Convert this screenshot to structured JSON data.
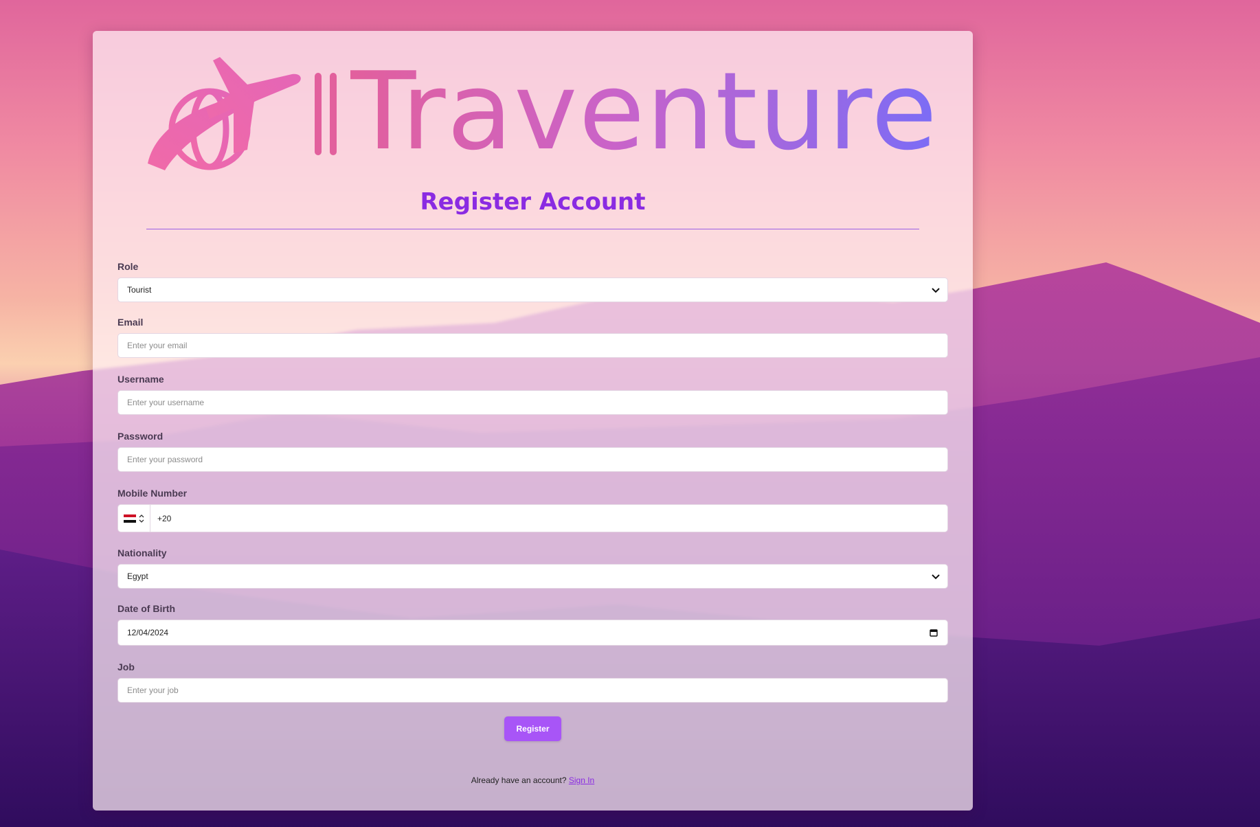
{
  "brand": {
    "name": "Traventure",
    "gradient_start": "#e2609d",
    "gradient_end": "#7b6cf6"
  },
  "form": {
    "title": "Register Account",
    "role": {
      "label": "Role",
      "value": "Tourist"
    },
    "email": {
      "label": "Email",
      "placeholder": "Enter your email"
    },
    "username": {
      "label": "Username",
      "placeholder": "Enter your username"
    },
    "password": {
      "label": "Password",
      "placeholder": "Enter your password"
    },
    "mobile": {
      "label": "Mobile Number",
      "value": "+20",
      "country_flag": "egypt-flag-icon"
    },
    "nationality": {
      "label": "Nationality",
      "value": "Egypt"
    },
    "dob": {
      "label": "Date of Birth",
      "value": "12/04/2024"
    },
    "job": {
      "label": "Job",
      "placeholder": "Enter your job"
    },
    "submit_label": "Register"
  },
  "footer": {
    "prompt": "Already have an account?",
    "link_label": "Sign In"
  },
  "colors": {
    "accent": "#a855f7",
    "title": "#8a2be2"
  }
}
